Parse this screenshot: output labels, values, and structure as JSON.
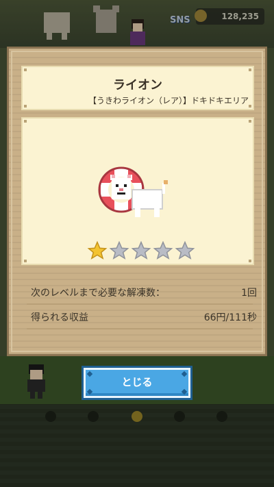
{
  "background": {
    "coin_count": "128,235",
    "sns_label": "SNS"
  },
  "modal": {
    "title": "ライオン",
    "subtitle": "【うきわライオン（レア）】ドキドキエリア",
    "rarity": {
      "filled": 1,
      "total": 5
    },
    "rows": [
      {
        "label": "次のレベルまで必要な解凍数：",
        "value": "1回"
      },
      {
        "label": "得られる収益",
        "value": "66円/111秒"
      }
    ],
    "close_label": "とじる"
  },
  "pagination": {
    "count": 5,
    "active_index": 2
  },
  "colors": {
    "wood": "#c9b088",
    "panel": "#fbf3d2",
    "accent_button": "#4aa7e4",
    "star_filled": "#f3c330",
    "star_empty": "#b9bcc5"
  }
}
